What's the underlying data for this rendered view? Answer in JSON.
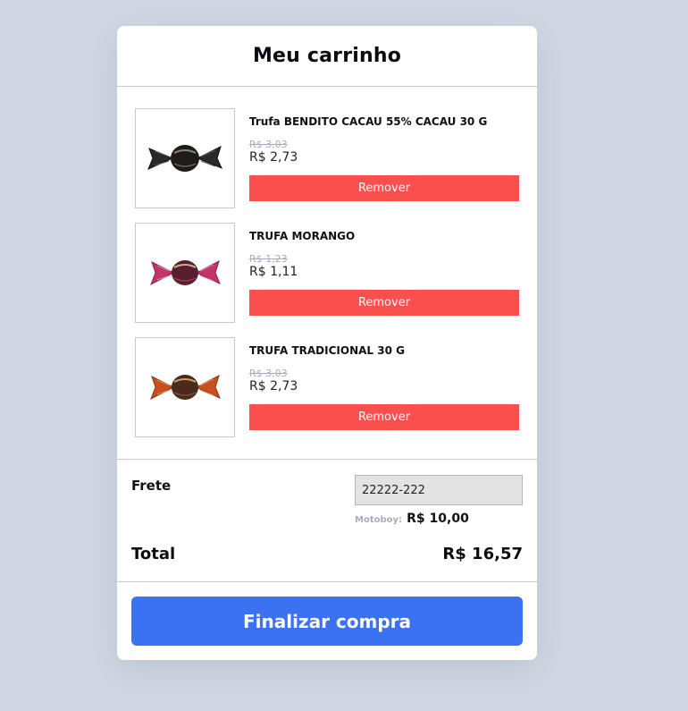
{
  "cart": {
    "title": "Meu carrinho",
    "items": [
      {
        "name": "Trufa BENDITO CACAU 55% CACAU 30 G",
        "old_price": "R$ 3,03",
        "price": "R$ 2,73",
        "remove_label": "Remover",
        "wrapper_color": "#2a2a2a"
      },
      {
        "name": "TRUFA MORANGO",
        "old_price": "R$ 1,23",
        "price": "R$ 1,11",
        "remove_label": "Remover",
        "wrapper_color": "#c2346a"
      },
      {
        "name": "TRUFA TRADICIONAL 30 G",
        "old_price": "R$ 3,03",
        "price": "R$ 2,73",
        "remove_label": "Remover",
        "wrapper_color": "#c8501f"
      }
    ],
    "shipping": {
      "label": "Frete",
      "cep_value": "22222-222",
      "method": "Motoboy:",
      "price": "R$ 10,00"
    },
    "total": {
      "label": "Total",
      "value": "R$ 16,57"
    },
    "checkout_label": "Finalizar compra"
  },
  "colors": {
    "background": "#d1d7e3",
    "remove_button": "#fa504d",
    "checkout_button": "#3b72f2",
    "muted_text": "#a5abc4"
  }
}
